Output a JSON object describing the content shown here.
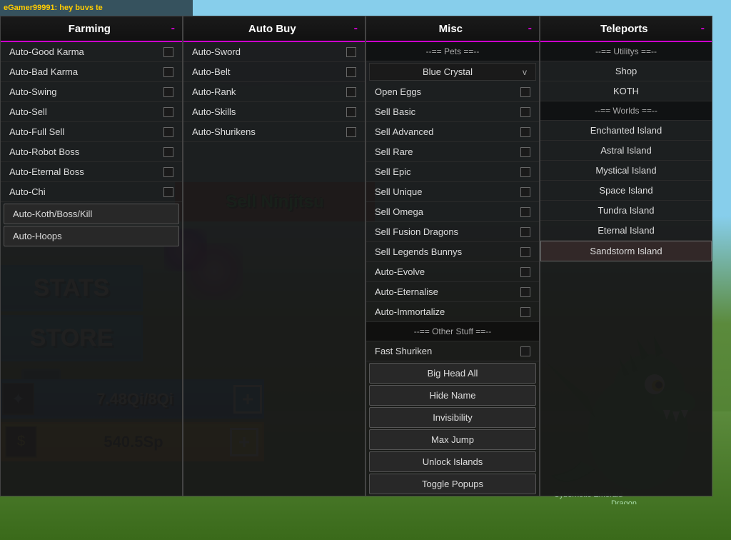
{
  "username": "eGamer99991: hey buvs te",
  "game": {
    "sell_sign": "Sell Ninjits",
    "stats_label": "STATS",
    "store_label": "STORE",
    "xp": "7.48Qi/8Qi",
    "gold": "540.5Sp",
    "plus": "+"
  },
  "menus": {
    "farming": {
      "title": "Farming",
      "close": "-",
      "items": [
        {
          "label": "Auto-Good Karma",
          "has_checkbox": true
        },
        {
          "label": "Auto-Bad Karma",
          "has_checkbox": true
        },
        {
          "label": "Auto-Swing",
          "has_checkbox": true
        },
        {
          "label": "Auto-Sell",
          "has_checkbox": true
        },
        {
          "label": "Auto-Full Sell",
          "has_checkbox": true
        },
        {
          "label": "Auto-Robot Boss",
          "has_checkbox": true
        },
        {
          "label": "Auto-Eternal Boss",
          "has_checkbox": true
        },
        {
          "label": "Auto-Chi",
          "has_checkbox": true
        },
        {
          "label": "Auto-Koth/Boss/Kill",
          "has_checkbox": false,
          "highlighted": true
        },
        {
          "label": "Auto-Hoops",
          "has_checkbox": false,
          "highlighted": true
        }
      ]
    },
    "auto_buy": {
      "title": "Auto Buy",
      "close": "-",
      "items": [
        {
          "label": "Auto-Sword",
          "has_checkbox": true
        },
        {
          "label": "Auto-Belt",
          "has_checkbox": true
        },
        {
          "label": "Auto-Rank",
          "has_checkbox": true
        },
        {
          "label": "Auto-Skills",
          "has_checkbox": true
        },
        {
          "label": "Auto-Shurikens",
          "has_checkbox": true
        }
      ]
    },
    "misc": {
      "title": "Misc",
      "close": "-",
      "pets_header": "--== Pets ==--",
      "pet_current": "Blue Crystal",
      "pet_nav": "v",
      "items": [
        {
          "label": "Open Eggs",
          "has_checkbox": true
        },
        {
          "label": "Sell Basic",
          "has_checkbox": true
        },
        {
          "label": "Sell Advanced",
          "has_checkbox": true
        },
        {
          "label": "Sell Rare",
          "has_checkbox": true
        },
        {
          "label": "Sell Epic",
          "has_checkbox": true
        },
        {
          "label": "Sell Unique",
          "has_checkbox": true
        },
        {
          "label": "Sell Omega",
          "has_checkbox": true
        },
        {
          "label": "Sell Fusion Dragons",
          "has_checkbox": true
        },
        {
          "label": "Sell Legends Bunnys",
          "has_checkbox": true
        },
        {
          "label": "Auto-Evolve",
          "has_checkbox": true
        },
        {
          "label": "Auto-Eternalise",
          "has_checkbox": true
        },
        {
          "label": "Auto-Immortalize",
          "has_checkbox": true
        }
      ],
      "other_header": "--== Other Stuff ==--",
      "other_items": [
        {
          "label": "Fast Shuriken",
          "has_checkbox": true
        },
        {
          "label": "Big Head All",
          "has_checkbox": false,
          "highlighted": true
        },
        {
          "label": "Hide Name",
          "has_checkbox": false,
          "highlighted": true
        },
        {
          "label": "Invisibility",
          "has_checkbox": false,
          "highlighted": true
        },
        {
          "label": "Max Jump",
          "has_checkbox": false,
          "highlighted": true
        },
        {
          "label": "Unlock Islands",
          "has_checkbox": false,
          "highlighted": true
        },
        {
          "label": "Toggle Popups",
          "has_checkbox": false,
          "highlighted": true
        }
      ]
    },
    "teleports": {
      "title": "Teleports",
      "close": "-",
      "utils_header": "--== Utilitys ==--",
      "utils_items": [
        {
          "label": "Shop"
        },
        {
          "label": "KOTH"
        }
      ],
      "worlds_header": "--== Worlds ==--",
      "world_items": [
        {
          "label": "Enchanted Island"
        },
        {
          "label": "Astral Island"
        },
        {
          "label": "Mystical Island"
        },
        {
          "label": "Space Island"
        },
        {
          "label": "Tundra Island"
        },
        {
          "label": "Eternal Island"
        },
        {
          "label": "Sandstorm Island"
        }
      ]
    }
  }
}
